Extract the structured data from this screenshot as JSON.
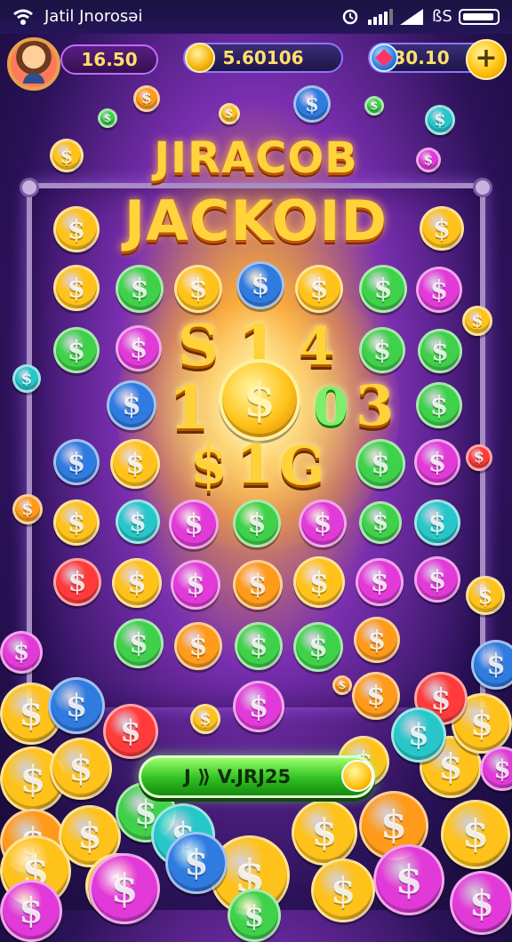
{
  "status_bar": {
    "carrier": "Jatil Jnorosəi",
    "right_text": "ßS"
  },
  "hud": {
    "level_value": "16.50",
    "coins_value": "5.60106",
    "gems_value": "30.10",
    "add_label": "+"
  },
  "title": {
    "line1": "JIRACOB",
    "line2": "JACKOID"
  },
  "jackpot_display": {
    "row1": [
      "S",
      "1",
      "4"
    ],
    "row2": [
      "1",
      "$",
      "0",
      "3"
    ],
    "row3": [
      "$",
      "1",
      "G"
    ]
  },
  "collect_button": {
    "label": "J  ⟫ V.JRJ25"
  },
  "colors": {
    "gold": "#ffc21a",
    "green": "#3fd14a",
    "blue": "#2f7be0",
    "pink": "#e23ad8",
    "orange": "#ff9a1a",
    "red": "#ff3b3b",
    "teal": "#27c7c9"
  }
}
